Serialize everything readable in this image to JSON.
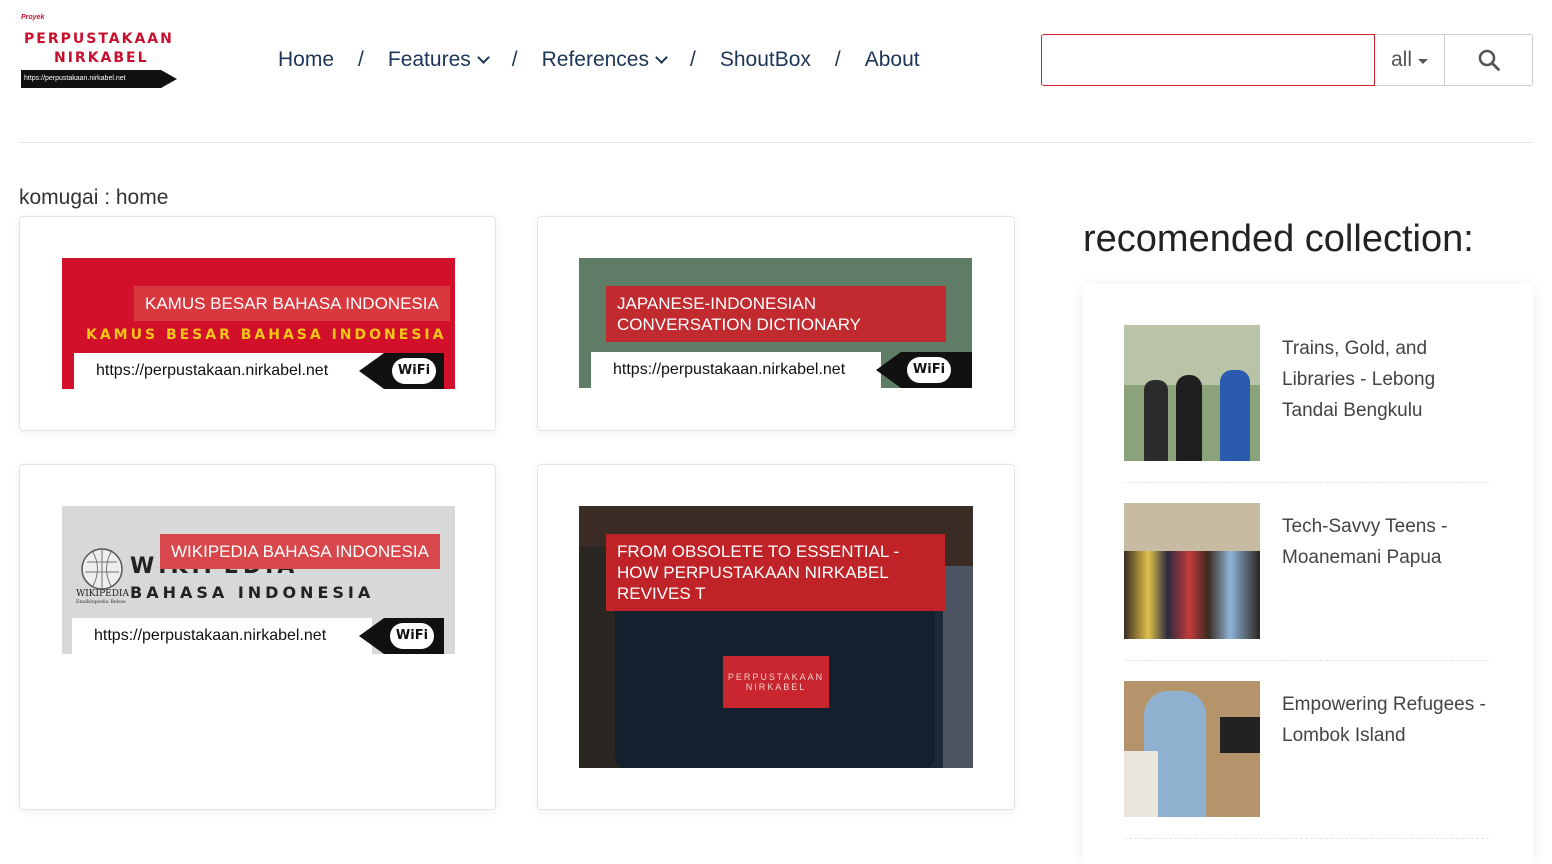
{
  "logo": {
    "small": "Proyek",
    "line1": "PERPUSTAKAAN",
    "line2": "NIRKABEL",
    "url": "https://perpustakaan.nirkabel.net"
  },
  "nav": {
    "home": "Home",
    "features": "Features",
    "references": "References",
    "shoutbox": "ShoutBox",
    "about": "About",
    "separator": "/"
  },
  "search": {
    "value": "",
    "scope": "all"
  },
  "breadcrumb": "komugai : home",
  "cards": [
    {
      "tag": "KAMUS BESAR BAHASA INDONESIA",
      "banner_text": "KAMUS BESAR BAHASA INDONESIA",
      "url": "https://perpustakaan.nirkabel.net",
      "wifi": "WiFi",
      "bg": "#d3102a"
    },
    {
      "tag": "JAPANESE-INDONESIAN CONVERSATION DICTIONARY",
      "url": "https://perpustakaan.nirkabel.net",
      "wifi": "WiFi",
      "bg": "#5e7c66"
    },
    {
      "tag": "WIKIPEDIA BAHASA INDONESIA",
      "wiki_word": "WIKIPEDIA",
      "wiki_sub": "BAHASA INDONESIA",
      "wiki_logo_title": "WIKIPEDIA",
      "wiki_logo_sub": "Ensiklopedia Bebas",
      "url": "https://perpustakaan.nirkabel.net",
      "wifi": "WiFi",
      "bg": "#d8d8d8"
    },
    {
      "tag": "FROM OBSOLETE TO ESSENTIAL - HOW PERPUSTAKAAN NIRKABEL REVIVES T",
      "device_label_1": "PERPUSTAKAAN",
      "device_label_2": "NIRKABEL",
      "bg": "#1e2a3a"
    }
  ],
  "sidebar": {
    "title": "recomended collection:",
    "items": [
      {
        "title": "Trains, Gold, and Libraries - Lebong Tandai Bengkulu"
      },
      {
        "title": "Tech-Savvy Teens - Moanemani Papua"
      },
      {
        "title": "Empowering Refugees - Lombok Island"
      }
    ]
  },
  "colors": {
    "accent": "#c9252f",
    "nav_text": "#1d3557"
  }
}
